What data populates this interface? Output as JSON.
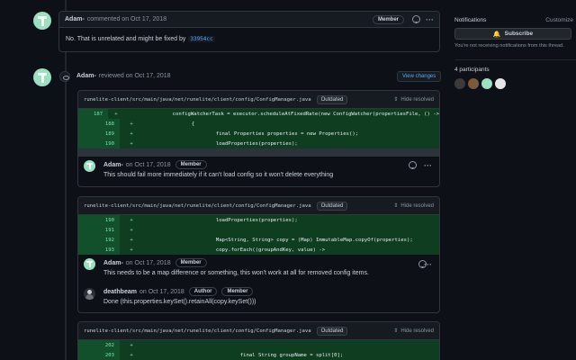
{
  "top_comment": {
    "author": "Adam-",
    "action": "commented on Oct 17, 2018",
    "badge": "Member",
    "body": "No. That is unrelated and might be fixed by",
    "commit": "33954cc"
  },
  "review": {
    "author": "Adam-",
    "action": "reviewed on Oct 17, 2018",
    "view_changes": "View changes"
  },
  "file_path": "runelite-client/src/main/java/net/runelite/client/config/ConfigManager.java",
  "outdated_label": "Outdated",
  "hide_resolved": "Hide resolved",
  "thread1": {
    "lines": [
      {
        "ln": "187",
        "sign": "+",
        "code": "                configWatcherTask = executor.scheduleAtFixedRate(new ConfigWatcher(propertiesFile, () ->"
      },
      {
        "ln": "188",
        "sign": "+",
        "code": "                {"
      },
      {
        "ln": "189",
        "sign": "+",
        "code": "                        final Properties properties = new Properties();"
      },
      {
        "ln": "190",
        "sign": "+",
        "code": "                        loadProperties(properties);"
      }
    ],
    "comment": {
      "author": "Adam-",
      "date": "on Oct 17, 2018",
      "badge": "Member",
      "body": "This should fail more immediately if it can't load config so it won't delete everything"
    }
  },
  "thread2": {
    "lines": [
      {
        "ln": "190",
        "sign": "+",
        "code": "                        loadProperties(properties);"
      },
      {
        "ln": "191",
        "sign": "+",
        "code": ""
      },
      {
        "ln": "192",
        "sign": "+",
        "code": "                        Map<String, String> copy = (Map) ImmutableMap.copyOf(properties);"
      },
      {
        "ln": "193",
        "sign": "+",
        "code": "                        copy.forEach((groupAndKey, value) ->"
      }
    ],
    "comment1": {
      "author": "Adam-",
      "date": "on Oct 17, 2018",
      "badge": "Member",
      "body": "This needs to be a map difference or something, this won't work at all for removed config items."
    },
    "comment2": {
      "author": "deathbeam",
      "date": "on Oct 17, 2018",
      "badge1": "Author",
      "badge2": "Member",
      "body": "Done (this.properties.keySet().retainAll(copy.keySet()))"
    }
  },
  "thread3": {
    "lines": [
      {
        "ln": "202",
        "sign": "+",
        "code": ""
      },
      {
        "ln": "203",
        "sign": "+",
        "code": "                                final String groupName = split[0];"
      }
    ]
  },
  "sidebar": {
    "notifications_label": "Notifications",
    "customize_label": "Customize",
    "subscribe_label": "Subscribe",
    "notif_text": "You're not receiving notifications from this thread.",
    "participants_label": "4 participants"
  }
}
